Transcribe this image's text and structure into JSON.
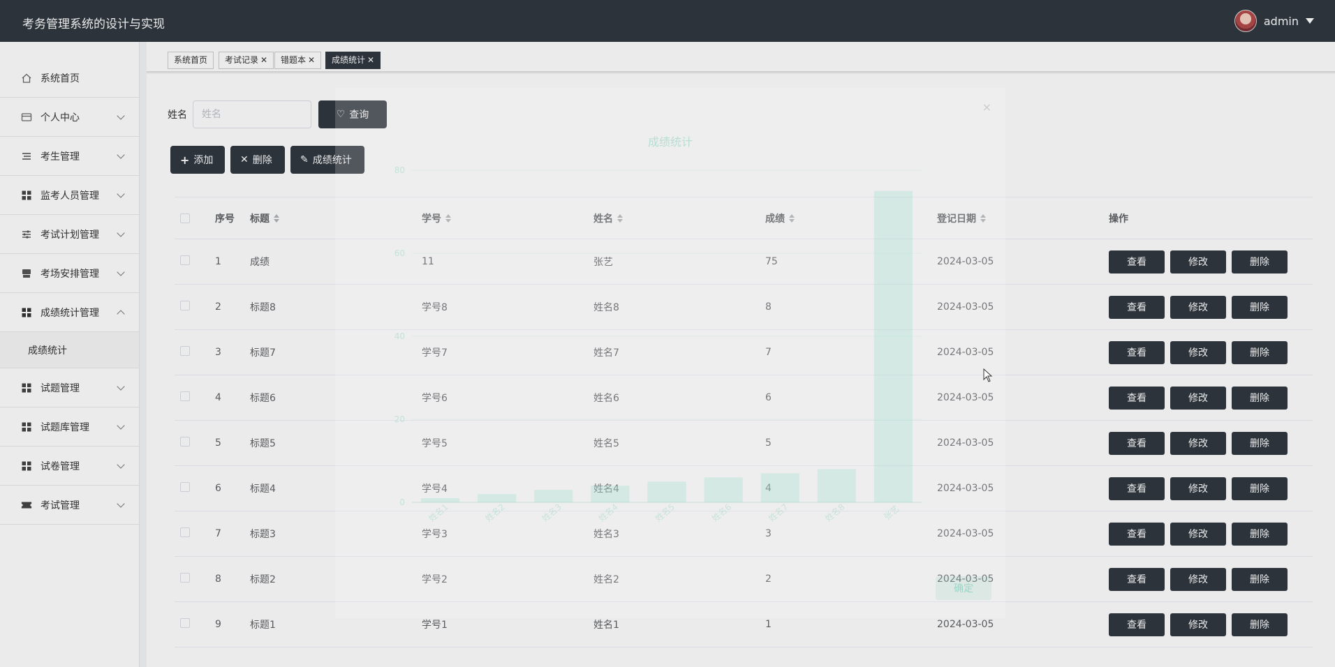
{
  "header": {
    "app_title": "考务管理系统的设计与实现",
    "user_name": "admin"
  },
  "sidebar": {
    "items": [
      {
        "label": "系统首页",
        "icon": "home-icon"
      },
      {
        "label": "个人中心",
        "icon": "card-icon"
      },
      {
        "label": "考生管理",
        "icon": "list-icon"
      },
      {
        "label": "监考人员管理",
        "icon": "grid-icon"
      },
      {
        "label": "考试计划管理",
        "icon": "sliders-icon"
      },
      {
        "label": "考场安排管理",
        "icon": "store-icon"
      },
      {
        "label": "成绩统计管理",
        "icon": "grid-icon"
      },
      {
        "label": "试题管理",
        "icon": "grid-icon"
      },
      {
        "label": "试题库管理",
        "icon": "grid-icon"
      },
      {
        "label": "试卷管理",
        "icon": "grid-icon"
      },
      {
        "label": "考试管理",
        "icon": "ticket-icon"
      }
    ],
    "submenu": {
      "label": "成绩统计"
    }
  },
  "tabs": [
    {
      "label": "系统首页"
    },
    {
      "label": "考试记录"
    },
    {
      "label": "错题本"
    },
    {
      "label": "成绩统计"
    }
  ],
  "search": {
    "label": "姓名",
    "placeholder": "姓名",
    "button_label": "查询"
  },
  "actions": {
    "add_label": "添加",
    "delete_label": "删除",
    "stats_label": "成绩统计"
  },
  "table": {
    "headers": {
      "index": "序号",
      "title": "标题",
      "student_no": "学号",
      "name": "姓名",
      "score": "成绩",
      "date": "登记日期",
      "ops": "操作"
    },
    "rows": [
      {
        "index": "1",
        "title": "成绩",
        "student_no": "11",
        "name": "张艺",
        "score": "75",
        "date": "2024-03-05"
      },
      {
        "index": "2",
        "title": "标题8",
        "student_no": "学号8",
        "name": "姓名8",
        "score": "8",
        "date": "2024-03-05"
      },
      {
        "index": "3",
        "title": "标题7",
        "student_no": "学号7",
        "name": "姓名7",
        "score": "7",
        "date": "2024-03-05"
      },
      {
        "index": "4",
        "title": "标题6",
        "student_no": "学号6",
        "name": "姓名6",
        "score": "6",
        "date": "2024-03-05"
      },
      {
        "index": "5",
        "title": "标题5",
        "student_no": "学号5",
        "name": "姓名5",
        "score": "5",
        "date": "2024-03-05"
      },
      {
        "index": "6",
        "title": "标题4",
        "student_no": "学号4",
        "name": "姓名4",
        "score": "4",
        "date": "2024-03-05"
      },
      {
        "index": "7",
        "title": "标题3",
        "student_no": "学号3",
        "name": "姓名3",
        "score": "3",
        "date": "2024-03-05"
      },
      {
        "index": "8",
        "title": "标题2",
        "student_no": "学号2",
        "name": "姓名2",
        "score": "2",
        "date": "2024-03-05"
      },
      {
        "index": "9",
        "title": "标题1",
        "student_no": "学号1",
        "name": "姓名1",
        "score": "1",
        "date": "2024-03-05"
      }
    ],
    "op_labels": {
      "view": "查看",
      "edit": "修改",
      "delete": "删除"
    }
  },
  "dialog": {
    "title": "成绩统计",
    "close": "×",
    "ok_label": "确定"
  },
  "chart_data": {
    "type": "bar",
    "title": "成绩统计",
    "categories": [
      "姓名1",
      "姓名2",
      "姓名3",
      "姓名4",
      "姓名5",
      "姓名6",
      "姓名7",
      "姓名8",
      "张艺"
    ],
    "values": [
      1,
      2,
      3,
      4,
      5,
      6,
      7,
      8,
      75
    ],
    "ylim": [
      0,
      80
    ],
    "yticks": [
      0,
      20,
      40,
      60,
      80
    ],
    "grid": true,
    "colors": {
      "bar": "#b4e4d6",
      "label": "#8fd3bf"
    }
  },
  "colors": {
    "topbar": "#303841",
    "button_dark": "#303841"
  }
}
